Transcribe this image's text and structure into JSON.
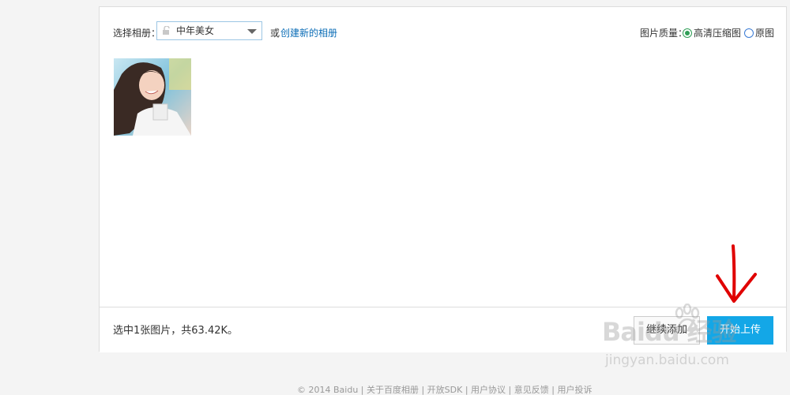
{
  "toolbar": {
    "album_label": "选择相册：",
    "album_selected": "中年美女",
    "or_text": "或",
    "create_album_link": "创建新的相册",
    "quality_label": "图片质量：",
    "quality_options": [
      {
        "label": "高清压缩图",
        "selected": true
      },
      {
        "label": "原图",
        "selected": false
      }
    ]
  },
  "photos": [
    {
      "name": "portrait-photo"
    }
  ],
  "footer_bar": {
    "summary": "选中1张图片，共63.42K。",
    "continue_button": "继续添加",
    "upload_button": "开始上传"
  },
  "watermark": {
    "main": "Baidu 经验",
    "sub": "jingyan.baidu.com"
  },
  "page_footer": "© 2014 Baidu | 关于百度相册 | 开放SDK | 用户协议 | 意见反馈 | 用户投诉",
  "colors": {
    "accent": "#13a7e7",
    "link": "#0a6cb6",
    "annotation_arrow": "#e00000"
  },
  "icons": {
    "lock": "lock-icon",
    "caret": "caret-down-icon",
    "arrow": "red-arrow-annotation"
  }
}
